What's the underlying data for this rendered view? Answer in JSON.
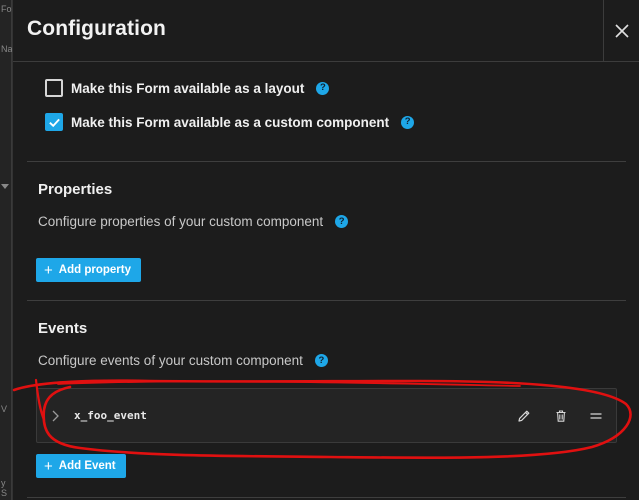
{
  "background": {
    "edge_texts": [
      "Fo",
      "Na",
      "V",
      "y S"
    ]
  },
  "dialog": {
    "title": "Configuration",
    "close_icon": "close-icon",
    "checkboxes": [
      {
        "label": "Make this Form available as a layout",
        "checked": false,
        "help": "?"
      },
      {
        "label": "Make this Form available as a custom component",
        "checked": true,
        "help": "?"
      }
    ],
    "properties": {
      "title": "Properties",
      "description": "Configure properties of your custom component",
      "help": "?",
      "add_button": "Add property"
    },
    "events": {
      "title": "Events",
      "description": "Configure events of your custom component",
      "help": "?",
      "items": [
        {
          "name": "x_foo_event",
          "icons": [
            "chevron-right-icon",
            "pencil-icon",
            "trash-icon",
            "drag-handle-icon"
          ]
        }
      ],
      "add_button": "Add Event"
    }
  },
  "colors": {
    "accent": "#1ea7e8",
    "dialog_bg": "#1c1c1c",
    "annotation": "#e01010"
  }
}
